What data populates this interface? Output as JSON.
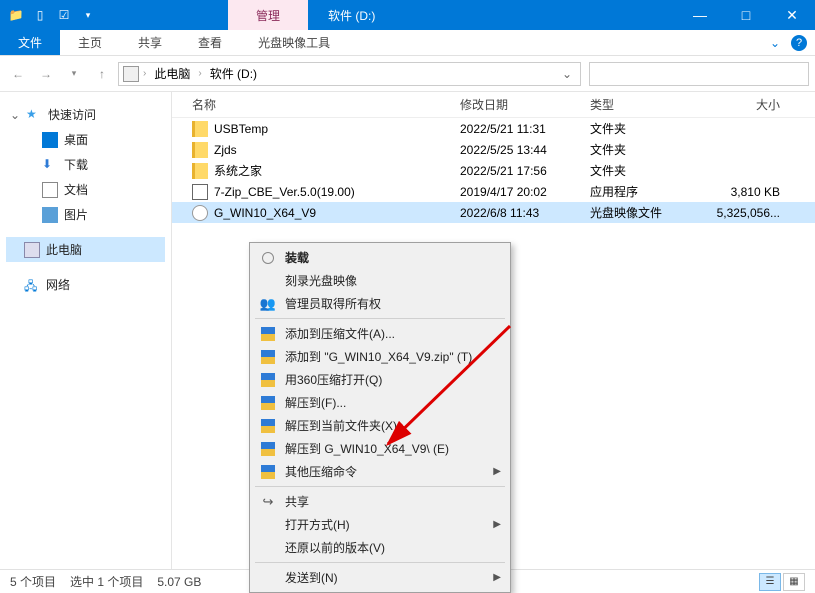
{
  "titlebar": {
    "manage_tab": "管理",
    "title": "软件 (D:)"
  },
  "ribbon": {
    "file": "文件",
    "tabs": [
      "主页",
      "共享",
      "查看",
      "光盘映像工具"
    ]
  },
  "breadcrumb": {
    "pc": "此电脑",
    "drive": "软件 (D:)"
  },
  "sidebar": {
    "quick": "快速访问",
    "desktop": "桌面",
    "download": "下载",
    "documents": "文档",
    "pictures": "图片",
    "this_pc": "此电脑",
    "network": "网络"
  },
  "columns": {
    "name": "名称",
    "date": "修改日期",
    "type": "类型",
    "size": "大小"
  },
  "files": [
    {
      "name": "USBTemp",
      "date": "2022/5/21 11:31",
      "type": "文件夹",
      "size": "",
      "icon": "folder"
    },
    {
      "name": "Zjds",
      "date": "2022/5/25 13:44",
      "type": "文件夹",
      "size": "",
      "icon": "folder"
    },
    {
      "name": "系统之家",
      "date": "2022/5/21 17:56",
      "type": "文件夹",
      "size": "",
      "icon": "folder"
    },
    {
      "name": "7-Zip_CBE_Ver.5.0(19.00)",
      "date": "2019/4/17 20:02",
      "type": "应用程序",
      "size": "3,810 KB",
      "icon": "zip"
    },
    {
      "name": "G_WIN10_X64_V9",
      "date": "2022/6/8 11:43",
      "type": "光盘映像文件",
      "size": "5,325,056...",
      "icon": "iso",
      "selected": true
    }
  ],
  "context": {
    "mount": "装载",
    "burn": "刻录光盘映像",
    "admin": "管理员取得所有权",
    "add_archive": "添加到压缩文件(A)...",
    "add_named": "添加到 \"G_WIN10_X64_V9.zip\" (T)",
    "open_360": "用360压缩打开(Q)",
    "extract_to": "解压到(F)...",
    "extract_here": "解压到当前文件夹(X)",
    "extract_named": "解压到 G_WIN10_X64_V9\\ (E)",
    "other_zip": "其他压缩命令",
    "share": "共享",
    "open_with": "打开方式(H)",
    "restore": "还原以前的版本(V)",
    "send_to": "发送到(N)"
  },
  "status": {
    "count": "5 个项目",
    "selected": "选中 1 个项目",
    "size": "5.07 GB"
  }
}
